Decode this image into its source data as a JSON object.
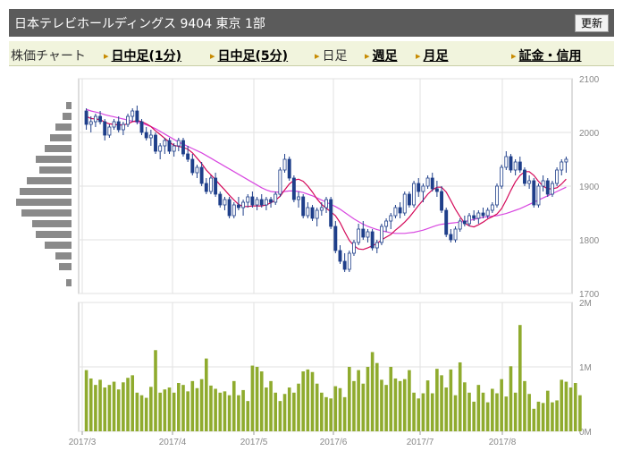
{
  "header": {
    "title": "日本テレビホールディングス 9404 東京 1部",
    "refresh_label": "更新"
  },
  "nav": {
    "chart_label": "株価チャート",
    "intraday_1min": "日中足(1分)",
    "intraday_5min": "日中足(5分)",
    "daily": "日足",
    "weekly": "週足",
    "monthly": "月足",
    "margin": "証金・信用"
  },
  "chart_data": {
    "type": "candlestick",
    "price_axis": {
      "ylim": [
        1700,
        2100
      ],
      "ticks": [
        "2100",
        "2000",
        "1900",
        "1800",
        "1700"
      ]
    },
    "volume_axis": {
      "ylim": [
        0,
        2000000
      ],
      "ticks": [
        "2M",
        "1M",
        "0M"
      ]
    },
    "x_tick_labels": [
      "2017/3",
      "2017/4",
      "2017/5",
      "2017/6",
      "2017/7",
      "2017/8"
    ],
    "candle_color": "#1f3f8a",
    "ma_short_color": "#d40a5a",
    "ma_long_color": "#d848e0",
    "volume_color": "#8fab2e",
    "price_profile_color": "#8a8a8a",
    "ohlc": [
      [
        2040,
        2045,
        2005,
        2015
      ],
      [
        2015,
        2030,
        2000,
        2020
      ],
      [
        2020,
        2035,
        2010,
        2030
      ],
      [
        2030,
        2040,
        2015,
        2020
      ],
      [
        2020,
        2025,
        1985,
        1995
      ],
      [
        1995,
        2015,
        1990,
        2010
      ],
      [
        2010,
        2025,
        2005,
        2020
      ],
      [
        2020,
        2030,
        2000,
        2005
      ],
      [
        2005,
        2020,
        1995,
        2015
      ],
      [
        2015,
        2035,
        2010,
        2030
      ],
      [
        2030,
        2045,
        2020,
        2040
      ],
      [
        2040,
        2050,
        2015,
        2020
      ],
      [
        2020,
        2025,
        1995,
        2000
      ],
      [
        2000,
        2010,
        1985,
        1990
      ],
      [
        1990,
        2005,
        1975,
        1995
      ],
      [
        1995,
        2000,
        1960,
        1965
      ],
      [
        1965,
        1980,
        1950,
        1975
      ],
      [
        1975,
        1990,
        1960,
        1985
      ],
      [
        1985,
        1990,
        1960,
        1965
      ],
      [
        1965,
        1980,
        1955,
        1975
      ],
      [
        1975,
        1990,
        1965,
        1985
      ],
      [
        1985,
        1990,
        1955,
        1960
      ],
      [
        1960,
        1975,
        1945,
        1950
      ],
      [
        1950,
        1960,
        1920,
        1925
      ],
      [
        1925,
        1940,
        1915,
        1935
      ],
      [
        1935,
        1945,
        1900,
        1905
      ],
      [
        1905,
        1915,
        1885,
        1890
      ],
      [
        1890,
        1920,
        1885,
        1915
      ],
      [
        1915,
        1925,
        1880,
        1885
      ],
      [
        1885,
        1890,
        1860,
        1865
      ],
      [
        1865,
        1880,
        1855,
        1875
      ],
      [
        1875,
        1880,
        1840,
        1845
      ],
      [
        1845,
        1870,
        1840,
        1865
      ],
      [
        1865,
        1880,
        1855,
        1860
      ],
      [
        1860,
        1875,
        1845,
        1870
      ],
      [
        1870,
        1885,
        1860,
        1880
      ],
      [
        1880,
        1890,
        1860,
        1865
      ],
      [
        1865,
        1880,
        1855,
        1875
      ],
      [
        1875,
        1885,
        1860,
        1865
      ],
      [
        1865,
        1880,
        1855,
        1875
      ],
      [
        1875,
        1880,
        1860,
        1870
      ],
      [
        1870,
        1890,
        1865,
        1885
      ],
      [
        1885,
        1935,
        1880,
        1930
      ],
      [
        1930,
        1960,
        1925,
        1950
      ],
      [
        1950,
        1955,
        1910,
        1915
      ],
      [
        1915,
        1920,
        1870,
        1875
      ],
      [
        1875,
        1890,
        1860,
        1880
      ],
      [
        1880,
        1885,
        1840,
        1845
      ],
      [
        1845,
        1870,
        1840,
        1860
      ],
      [
        1860,
        1865,
        1835,
        1840
      ],
      [
        1840,
        1860,
        1825,
        1855
      ],
      [
        1855,
        1870,
        1845,
        1860
      ],
      [
        1860,
        1880,
        1850,
        1875
      ],
      [
        1875,
        1880,
        1820,
        1825
      ],
      [
        1825,
        1835,
        1775,
        1780
      ],
      [
        1780,
        1790,
        1755,
        1760
      ],
      [
        1760,
        1775,
        1740,
        1745
      ],
      [
        1745,
        1780,
        1740,
        1775
      ],
      [
        1775,
        1800,
        1770,
        1795
      ],
      [
        1795,
        1830,
        1790,
        1820
      ],
      [
        1820,
        1835,
        1800,
        1805
      ],
      [
        1805,
        1820,
        1795,
        1815
      ],
      [
        1815,
        1820,
        1780,
        1785
      ],
      [
        1785,
        1800,
        1775,
        1795
      ],
      [
        1795,
        1830,
        1790,
        1825
      ],
      [
        1825,
        1840,
        1815,
        1835
      ],
      [
        1835,
        1850,
        1820,
        1845
      ],
      [
        1845,
        1865,
        1840,
        1860
      ],
      [
        1860,
        1870,
        1840,
        1850
      ],
      [
        1850,
        1890,
        1845,
        1885
      ],
      [
        1885,
        1890,
        1860,
        1865
      ],
      [
        1865,
        1910,
        1860,
        1905
      ],
      [
        1905,
        1915,
        1880,
        1890
      ],
      [
        1890,
        1905,
        1870,
        1900
      ],
      [
        1900,
        1920,
        1895,
        1915
      ],
      [
        1915,
        1925,
        1890,
        1895
      ],
      [
        1895,
        1910,
        1880,
        1890
      ],
      [
        1890,
        1900,
        1850,
        1855
      ],
      [
        1855,
        1860,
        1805,
        1810
      ],
      [
        1810,
        1820,
        1795,
        1800
      ],
      [
        1800,
        1825,
        1795,
        1820
      ],
      [
        1820,
        1840,
        1815,
        1835
      ],
      [
        1835,
        1845,
        1825,
        1830
      ],
      [
        1830,
        1850,
        1825,
        1845
      ],
      [
        1845,
        1855,
        1835,
        1840
      ],
      [
        1840,
        1855,
        1830,
        1850
      ],
      [
        1850,
        1860,
        1840,
        1845
      ],
      [
        1845,
        1860,
        1840,
        1855
      ],
      [
        1855,
        1870,
        1850,
        1865
      ],
      [
        1865,
        1905,
        1860,
        1900
      ],
      [
        1900,
        1940,
        1895,
        1935
      ],
      [
        1935,
        1965,
        1930,
        1955
      ],
      [
        1955,
        1960,
        1925,
        1930
      ],
      [
        1930,
        1950,
        1920,
        1945
      ],
      [
        1945,
        1955,
        1925,
        1930
      ],
      [
        1930,
        1935,
        1900,
        1905
      ],
      [
        1905,
        1920,
        1895,
        1910
      ],
      [
        1910,
        1915,
        1860,
        1865
      ],
      [
        1865,
        1905,
        1860,
        1900
      ],
      [
        1900,
        1920,
        1890,
        1910
      ],
      [
        1910,
        1915,
        1880,
        1885
      ],
      [
        1885,
        1910,
        1880,
        1905
      ],
      [
        1905,
        1935,
        1900,
        1930
      ],
      [
        1930,
        1950,
        1920,
        1945
      ],
      [
        1945,
        1955,
        1925,
        1950
      ]
    ],
    "ma_short": [
      2030,
      2026,
      2025,
      2024,
      2019,
      2016,
      2015,
      2014,
      2014,
      2016,
      2020,
      2022,
      2020,
      2016,
      2011,
      2003,
      1996,
      1989,
      1982,
      1976,
      1974,
      1972,
      1969,
      1962,
      1952,
      1942,
      1930,
      1921,
      1912,
      1902,
      1893,
      1883,
      1874,
      1866,
      1862,
      1862,
      1863,
      1863,
      1863,
      1865,
      1869,
      1874,
      1881,
      1893,
      1904,
      1911,
      1913,
      1909,
      1900,
      1889,
      1876,
      1866,
      1859,
      1852,
      1845,
      1832,
      1815,
      1799,
      1789,
      1783,
      1782,
      1785,
      1789,
      1793,
      1800,
      1805,
      1810,
      1818,
      1825,
      1833,
      1842,
      1853,
      1864,
      1874,
      1885,
      1893,
      1898,
      1898,
      1889,
      1873,
      1857,
      1843,
      1831,
      1826,
      1824,
      1828,
      1833,
      1839,
      1843,
      1848,
      1858,
      1874,
      1892,
      1908,
      1920,
      1927,
      1927,
      1920,
      1909,
      1900,
      1895,
      1895,
      1897,
      1904,
      1913
    ],
    "ma_long": [
      2043,
      2040,
      2038,
      2036,
      2033,
      2031,
      2029,
      2027,
      2025,
      2023,
      2021,
      2019,
      2017,
      2014,
      2011,
      2007,
      2002,
      1997,
      1992,
      1987,
      1982,
      1978,
      1974,
      1970,
      1966,
      1962,
      1957,
      1952,
      1947,
      1942,
      1937,
      1932,
      1927,
      1922,
      1917,
      1912,
      1907,
      1902,
      1897,
      1893,
      1890,
      1889,
      1889,
      1890,
      1891,
      1891,
      1890,
      1888,
      1885,
      1882,
      1878,
      1874,
      1870,
      1866,
      1862,
      1857,
      1851,
      1845,
      1839,
      1834,
      1829,
      1825,
      1822,
      1819,
      1817,
      1815,
      1813,
      1812,
      1812,
      1812,
      1813,
      1814,
      1816,
      1818,
      1821,
      1824,
      1827,
      1829,
      1830,
      1831,
      1832,
      1833,
      1834,
      1836,
      1838,
      1840,
      1842,
      1843,
      1844,
      1845,
      1847,
      1849,
      1852,
      1855,
      1858,
      1862,
      1866,
      1870,
      1874,
      1878,
      1882,
      1886,
      1890,
      1894,
      1898
    ],
    "volume": [
      950000,
      820000,
      720000,
      800000,
      680000,
      720000,
      770000,
      650000,
      760000,
      830000,
      870000,
      600000,
      560000,
      520000,
      690000,
      1260000,
      600000,
      650000,
      680000,
      600000,
      750000,
      720000,
      620000,
      780000,
      670000,
      810000,
      1130000,
      710000,
      660000,
      600000,
      620000,
      560000,
      780000,
      560000,
      640000,
      470000,
      1020000,
      1000000,
      930000,
      680000,
      780000,
      600000,
      470000,
      580000,
      680000,
      600000,
      740000,
      930000,
      960000,
      920000,
      740000,
      600000,
      530000,
      510000,
      700000,
      670000,
      530000,
      1000000,
      780000,
      950000,
      740000,
      1000000,
      1230000,
      1060000,
      800000,
      720000,
      1000000,
      820000,
      780000,
      810000,
      950000,
      600000,
      510000,
      590000,
      790000,
      590000,
      970000,
      870000,
      680000,
      960000,
      560000,
      1070000,
      760000,
      600000,
      460000,
      720000,
      600000,
      450000,
      660000,
      590000,
      810000,
      540000,
      1010000,
      600000,
      1650000,
      780000,
      580000,
      350000,
      460000,
      440000,
      630000,
      450000,
      480000,
      800000,
      770000,
      680000,
      750000,
      560000
    ],
    "price_profile": [
      {
        "price": 2050,
        "width": 6
      },
      {
        "price": 2030,
        "width": 10
      },
      {
        "price": 2010,
        "width": 18
      },
      {
        "price": 1990,
        "width": 24
      },
      {
        "price": 1970,
        "width": 30
      },
      {
        "price": 1950,
        "width": 40
      },
      {
        "price": 1930,
        "width": 36
      },
      {
        "price": 1910,
        "width": 50
      },
      {
        "price": 1890,
        "width": 58
      },
      {
        "price": 1870,
        "width": 62
      },
      {
        "price": 1850,
        "width": 56
      },
      {
        "price": 1830,
        "width": 44
      },
      {
        "price": 1810,
        "width": 40
      },
      {
        "price": 1790,
        "width": 30
      },
      {
        "price": 1770,
        "width": 18
      },
      {
        "price": 1750,
        "width": 14
      },
      {
        "price": 1720,
        "width": 6
      }
    ]
  }
}
